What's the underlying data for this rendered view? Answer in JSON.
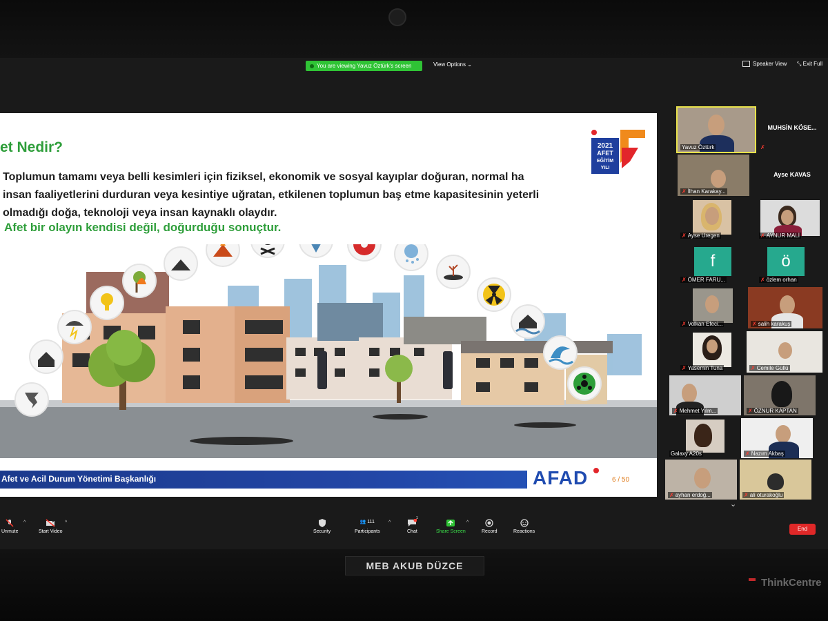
{
  "zoom": {
    "viewing_badge": "You are viewing Yavuz Öztürk's screen",
    "view_options": "View Options",
    "speaker_view": "Speaker View",
    "exit_full": "Exit Full"
  },
  "slide": {
    "title": "et Nedir?",
    "body_lines": [
      "Toplumun tamamı veya belli kesimleri için fiziksel, ekonomik ve sosyal kayıplar doğuran, normal ha",
      "insan faaliyetlerini durduran veya kesintiye uğratan, etkilenen toplumun baş etme kapasitesinin yeterli",
      "olmadığı doğa, teknoloji veya insan kaynaklı olaydır."
    ],
    "emphasis": "Afet bir olayın kendisi değil, doğurduğu sonuçtur.",
    "logo_year": "2021",
    "logo_line1": "AFET",
    "logo_line2": "EĞİTİM",
    "logo_line3": "YILI",
    "footer_text": "Afet ve Acil Durum Yönetimi Başkanlığı",
    "brand": "AFAD",
    "page": "6 / 50",
    "hazard_icons": [
      "tornado-icon",
      "house-damage-icon",
      "storm-icon",
      "explosion-icon",
      "fire-tree-icon",
      "landslide-icon",
      "volcano-icon",
      "skull-icon",
      "iceberg-icon",
      "biohazard-icon",
      "hail-icon",
      "drought-icon",
      "radiation-icon",
      "flood-house-icon",
      "tsunami-icon",
      "chemical-icon"
    ]
  },
  "participants": [
    {
      "name": "Yavuz Öztürk",
      "type": "video",
      "active": true
    },
    {
      "name": "MUHSİN KÖSE...",
      "type": "name"
    },
    {
      "name": "İlhan Karakay...",
      "type": "video"
    },
    {
      "name": "Ayse KAVAS",
      "type": "name"
    },
    {
      "name": "Ayse Uregen",
      "type": "video"
    },
    {
      "name": "AYNUR MALİ",
      "type": "video"
    },
    {
      "name": "ÖMER FARU...",
      "type": "letter",
      "letter": "f"
    },
    {
      "name": "özlem orhan",
      "type": "letter",
      "letter": "ö"
    },
    {
      "name": "Volkan Efeci...",
      "type": "video"
    },
    {
      "name": "salih karakuş",
      "type": "video"
    },
    {
      "name": "Yasemin Tuna",
      "type": "video"
    },
    {
      "name": "Cemile Güllü",
      "type": "video"
    },
    {
      "name": "Mehmet Yılm...",
      "type": "video"
    },
    {
      "name": "ÖZNUR KAPTAN",
      "type": "video"
    },
    {
      "name": "Galaxy A20s",
      "type": "video"
    },
    {
      "name": "Nazım Akbaş",
      "type": "video"
    },
    {
      "name": "ayhan erdoğ...",
      "type": "video"
    },
    {
      "name": "ali oturakoğlu",
      "type": "video"
    }
  ],
  "toolbar": {
    "unmute": "Unmute",
    "start_video": "Start Video",
    "security": "Security",
    "participants": "Participants",
    "participants_count": "111",
    "chat": "Chat",
    "chat_badge": "1",
    "share_screen": "Share Screen",
    "record": "Record",
    "reactions": "Reactions",
    "end": "End"
  },
  "hardware": {
    "label": "MEB AKUB DÜZCE",
    "brand": "ThinkCentre"
  },
  "colors": {
    "green": "#2e9e3a",
    "zoom_green": "#2fc335",
    "afad_blue": "#1f4bb0",
    "end_red": "#e02828"
  }
}
